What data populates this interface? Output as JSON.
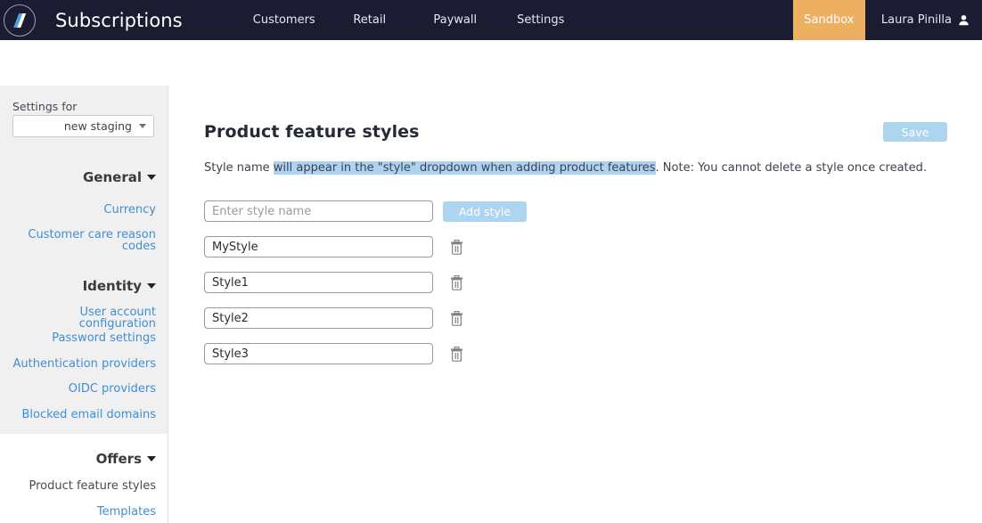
{
  "header": {
    "logo_icon": "atom-logo-icon",
    "brand": "Subscriptions",
    "nav": [
      {
        "label": "Customers"
      },
      {
        "label": "Retail"
      },
      {
        "label": "Paywall"
      },
      {
        "label": "Settings"
      }
    ],
    "env_badge": "Sandbox",
    "env_badge_color": "#edaf62",
    "user_name": "Laura Pinilla",
    "user_icon": "user-avatar-icon"
  },
  "sidebar": {
    "settings_for_label": "Settings for",
    "environment_value": "new staging",
    "groups": [
      {
        "title": "General",
        "items": [
          {
            "label": "Currency",
            "active": false
          },
          {
            "label": "Customer care reason codes",
            "active": false
          }
        ]
      },
      {
        "title": "Identity",
        "items": [
          {
            "label": "User account configuration",
            "active": false
          },
          {
            "label": "Password settings",
            "active": false
          },
          {
            "label": "Authentication providers",
            "active": false
          },
          {
            "label": "OIDC providers",
            "active": false
          },
          {
            "label": "Blocked email domains",
            "active": false
          }
        ]
      },
      {
        "title": "Offers",
        "items": [
          {
            "label": "Product feature styles",
            "active": true
          },
          {
            "label": "Templates",
            "active": false
          }
        ]
      }
    ]
  },
  "main": {
    "title": "Product feature styles",
    "save_label": "Save",
    "help_prefix": "Style name ",
    "help_selected": "will appear in the \"style\" dropdown when adding product features",
    "help_suffix": ". Note: You cannot delete a style once created.",
    "new_style_placeholder": "Enter style name",
    "new_style_value": "",
    "add_style_label": "Add style",
    "delete_icon": "trash-icon",
    "styles": [
      {
        "value": "MyStyle"
      },
      {
        "value": "Style1"
      },
      {
        "value": "Style2"
      },
      {
        "value": "Style3"
      }
    ]
  },
  "colors": {
    "topbar": "#1b1c32",
    "accent_disabled": "#aed5ef",
    "link": "#3f8fd2",
    "sandbox": "#edaf62",
    "selection": "#aed2f2"
  }
}
